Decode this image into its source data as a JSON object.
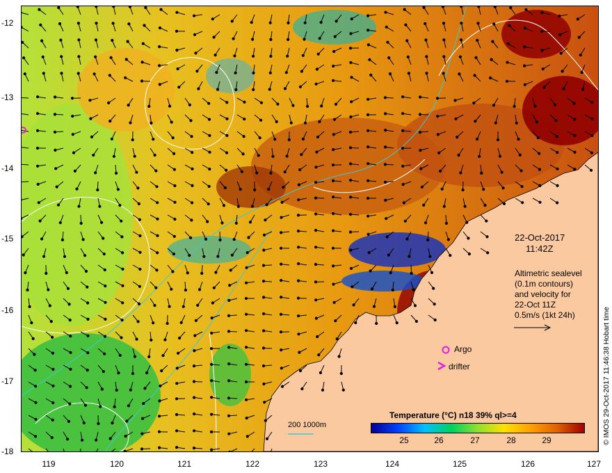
{
  "title": {
    "date": "22-Oct-2017",
    "time": "11:42Z"
  },
  "velocity_note": [
    "Altimetric sealevel",
    "(0.1m contours)",
    "and velocity for",
    "22-Oct 11Z",
    "0.5m/s (1kt 24h)"
  ],
  "legend": {
    "argo": "Argo",
    "drifter": "drifter",
    "bathymetry": "200  1000m"
  },
  "colorbar": {
    "title": "Temperature (°C) n18 39% ql>=4",
    "ticks": [
      "25",
      "26",
      "27",
      "28",
      "29"
    ],
    "colors": [
      "#000090",
      "#0040ff",
      "#00c0ff",
      "#00d060",
      "#90e030",
      "#ffe000",
      "#ffa000",
      "#e06000",
      "#a00000"
    ]
  },
  "axes": {
    "y_ticks": [
      "-12",
      "-13",
      "-14",
      "-15",
      "-16",
      "-17",
      "-18"
    ],
    "x_ticks": [
      "119",
      "120",
      "121",
      "122",
      "123",
      "124",
      "125",
      "126",
      "127"
    ]
  },
  "credit": "© IMOS 29-Oct-2017 11:46:38 Hobart time",
  "colors": {
    "land": "#fbc9a0",
    "argo_marker": "#e020e0",
    "drifter_marker": "#e020e0",
    "isobath": "#40c8d0"
  }
}
